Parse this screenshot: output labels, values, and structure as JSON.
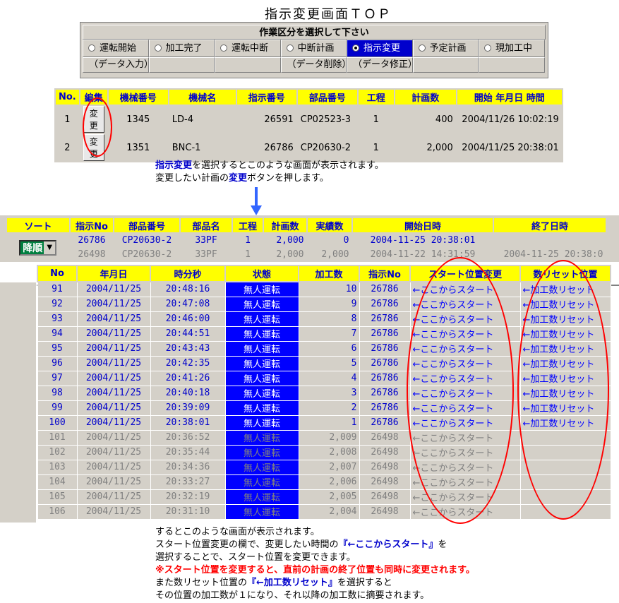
{
  "page_title": "指示変更画面ＴＯＰ",
  "work_panel": {
    "header": "作業区分を選択して下さい",
    "options": [
      {
        "label": "運転開始",
        "selected": false
      },
      {
        "label": "加工完了",
        "selected": false
      },
      {
        "label": "運転中断",
        "selected": false
      },
      {
        "label": "中断計画",
        "selected": false
      },
      {
        "label": "指示変更",
        "selected": true
      },
      {
        "label": "予定計画",
        "selected": false
      },
      {
        "label": "現加工中",
        "selected": false
      }
    ],
    "sub_labels": [
      "（データ入力）",
      "",
      "",
      "（データ削除）",
      "（データ修正）",
      "",
      ""
    ]
  },
  "plan_table": {
    "headers": [
      "No.",
      "編集",
      "機械番号",
      "機械名",
      "指示番号",
      "部品番号",
      "工程",
      "計画数",
      "開始 年月日 時間"
    ],
    "rows": [
      {
        "no": "1",
        "button": "変更",
        "machine_no": "1345",
        "machine_name": "LD-4",
        "instruction_no": "26591",
        "part_no": "CP02523-3",
        "process": "1",
        "plan_qty": "400",
        "start": "2004/11/26 10:02:19"
      },
      {
        "no": "2",
        "button": "変更",
        "machine_no": "1351",
        "machine_name": "BNC-1",
        "instruction_no": "26786",
        "part_no": "CP20630-2",
        "process": "1",
        "plan_qty": "2,000",
        "start": "2004/11/25 20:38:01"
      }
    ]
  },
  "explanation1": {
    "line1_highlight": "指示変更",
    "line1_rest": "を選択するとこのような画面が表示されます。",
    "line2_pre": "変更したい計画の",
    "line2_highlight": "変更",
    "line2_post": "ボタンを押します。"
  },
  "sort_table": {
    "sort_label": "ソート",
    "sort_value": "降順",
    "headers": [
      "指示No",
      "部品番号",
      "部品名",
      "工程",
      "計画数",
      "実績数",
      "開始日時",
      "終了日時"
    ],
    "rows": [
      {
        "instruction_no": "26786",
        "part_no": "CP20630-2",
        "part_name": "33PF",
        "process": "1",
        "plan_qty": "2,000",
        "actual_qty": "0",
        "start": "2004-11-25 20:38:01",
        "end": ""
      },
      {
        "instruction_no": "26498",
        "part_no": "CP20630-2",
        "part_name": "33PF",
        "process": "1",
        "plan_qty": "2,000",
        "actual_qty": "2,000",
        "start": "2004-11-22 14:31:59",
        "end": "2004-11-25 20:38:0"
      }
    ]
  },
  "main_table": {
    "headers": [
      "No",
      "年月日",
      "時分秒",
      "状態",
      "加工数",
      "指示No",
      "スタート位置変更",
      "数リセット位置"
    ],
    "rows": [
      {
        "no": "91",
        "date": "2004/11/25",
        "time": "20:48:16",
        "status": "無人運転",
        "count": "10",
        "instruction_no": "26786",
        "start_link": "←ここからスタート",
        "reset_link": "←加工数リセット",
        "gray": false
      },
      {
        "no": "92",
        "date": "2004/11/25",
        "time": "20:47:08",
        "status": "無人運転",
        "count": "9",
        "instruction_no": "26786",
        "start_link": "←ここからスタート",
        "reset_link": "←加工数リセット",
        "gray": false
      },
      {
        "no": "93",
        "date": "2004/11/25",
        "time": "20:46:00",
        "status": "無人運転",
        "count": "8",
        "instruction_no": "26786",
        "start_link": "←ここからスタート",
        "reset_link": "←加工数リセット",
        "gray": false
      },
      {
        "no": "94",
        "date": "2004/11/25",
        "time": "20:44:51",
        "status": "無人運転",
        "count": "7",
        "instruction_no": "26786",
        "start_link": "←ここからスタート",
        "reset_link": "←加工数リセット",
        "gray": false
      },
      {
        "no": "95",
        "date": "2004/11/25",
        "time": "20:43:43",
        "status": "無人運転",
        "count": "6",
        "instruction_no": "26786",
        "start_link": "←ここからスタート",
        "reset_link": "←加工数リセット",
        "gray": false
      },
      {
        "no": "96",
        "date": "2004/11/25",
        "time": "20:42:35",
        "status": "無人運転",
        "count": "5",
        "instruction_no": "26786",
        "start_link": "←ここからスタート",
        "reset_link": "←加工数リセット",
        "gray": false
      },
      {
        "no": "97",
        "date": "2004/11/25",
        "time": "20:41:26",
        "status": "無人運転",
        "count": "4",
        "instruction_no": "26786",
        "start_link": "←ここからスタート",
        "reset_link": "←加工数リセット",
        "gray": false
      },
      {
        "no": "98",
        "date": "2004/11/25",
        "time": "20:40:18",
        "status": "無人運転",
        "count": "3",
        "instruction_no": "26786",
        "start_link": "←ここからスタート",
        "reset_link": "←加工数リセット",
        "gray": false
      },
      {
        "no": "99",
        "date": "2004/11/25",
        "time": "20:39:09",
        "status": "無人運転",
        "count": "2",
        "instruction_no": "26786",
        "start_link": "←ここからスタート",
        "reset_link": "←加工数リセット",
        "gray": false
      },
      {
        "no": "100",
        "date": "2004/11/25",
        "time": "20:38:01",
        "status": "無人運転",
        "count": "1",
        "instruction_no": "26786",
        "start_link": "←ここからスタート",
        "reset_link": "←加工数リセット",
        "gray": false
      },
      {
        "no": "101",
        "date": "2004/11/25",
        "time": "20:36:52",
        "status": "無人運転",
        "count": "2,009",
        "instruction_no": "26498",
        "start_link": "←ここからスタート",
        "reset_link": "",
        "gray": true
      },
      {
        "no": "102",
        "date": "2004/11/25",
        "time": "20:35:44",
        "status": "無人運転",
        "count": "2,008",
        "instruction_no": "26498",
        "start_link": "←ここからスタート",
        "reset_link": "",
        "gray": true
      },
      {
        "no": "103",
        "date": "2004/11/25",
        "time": "20:34:36",
        "status": "無人運転",
        "count": "2,007",
        "instruction_no": "26498",
        "start_link": "←ここからスタート",
        "reset_link": "",
        "gray": true
      },
      {
        "no": "104",
        "date": "2004/11/25",
        "time": "20:33:27",
        "status": "無人運転",
        "count": "2,006",
        "instruction_no": "26498",
        "start_link": "←ここからスタート",
        "reset_link": "",
        "gray": true
      },
      {
        "no": "105",
        "date": "2004/11/25",
        "time": "20:32:19",
        "status": "無人運転",
        "count": "2,005",
        "instruction_no": "26498",
        "start_link": "←ここからスタート",
        "reset_link": "",
        "gray": true
      },
      {
        "no": "106",
        "date": "2004/11/25",
        "time": "20:31:10",
        "status": "無人運転",
        "count": "2,004",
        "instruction_no": "26498",
        "start_link": "←ここからスタート",
        "reset_link": "",
        "gray": true
      }
    ]
  },
  "explanation2": {
    "line1": "するとこのような画面が表示されます。",
    "line2_pre": "スタート位置変更の欄で、変更したい時間の",
    "line2_highlight": "『←ここからスタート』",
    "line2_post": "を",
    "line3": "選択することで、スタート位置を変更できます。",
    "line4_red": "※スタート位置を変更すると、直前の計画の終了位置も同時に変更されます。",
    "line5_pre": "また数リセット位置の",
    "line5_highlight": "『←加工数リセット』",
    "line5_post": "を選択すると",
    "line6": "その位置の加工数が１になり、それ以降の加工数に摘要されます。"
  },
  "colors": {
    "header_yellow": "#ffff00",
    "header_text": "#0000cc",
    "status_blue": "#0000ff",
    "panel_gray": "#d4d0c8",
    "annotation_red": "#ff0000",
    "sort_green": "#008040"
  }
}
